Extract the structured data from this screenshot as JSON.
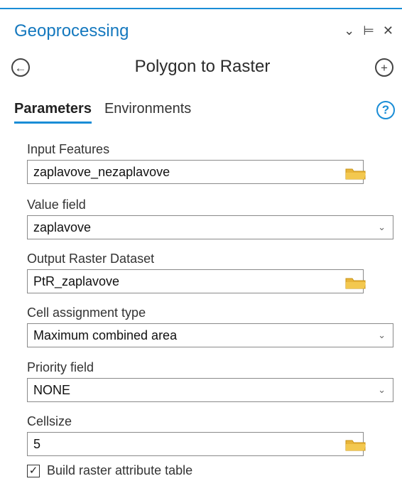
{
  "header": {
    "title": "Geoprocessing",
    "controls": {
      "options": "⌄",
      "pin": "⊨",
      "close": "✕"
    }
  },
  "tool": {
    "back_glyph": "←",
    "title": "Polygon to Raster",
    "add_glyph": "+"
  },
  "tabs": [
    {
      "label": "Parameters",
      "active": true
    },
    {
      "label": "Environments",
      "active": false
    }
  ],
  "help_glyph": "?",
  "params": [
    {
      "label": "Input Features",
      "value": "zaplavove_nezaplavove",
      "dropdown": true,
      "browse": true
    },
    {
      "label": "Value field",
      "value": "zaplavove",
      "dropdown": true,
      "browse": false
    },
    {
      "label": "Output Raster Dataset",
      "value": "PtR_zaplavove",
      "dropdown": false,
      "browse": true
    },
    {
      "label": "Cell assignment type",
      "value": "Maximum combined area",
      "dropdown": true,
      "browse": false
    },
    {
      "label": "Priority field",
      "value": "NONE",
      "dropdown": true,
      "browse": false
    },
    {
      "label": "Cellsize",
      "value": "5",
      "dropdown": false,
      "browse": true
    }
  ],
  "checkbox": {
    "label": "Build raster attribute table",
    "checked": true,
    "glyph": "✓"
  },
  "colors": {
    "accent": "#1a8dd6",
    "title": "#1478be",
    "folder": "#e8b53a"
  }
}
